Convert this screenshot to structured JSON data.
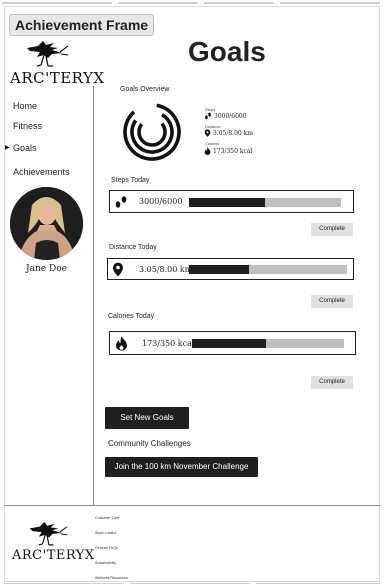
{
  "frame": {
    "label": "Achievement Frame"
  },
  "brand": {
    "logo_text": "ARC'TERYX"
  },
  "page": {
    "title": "Goals"
  },
  "nav": {
    "items": [
      {
        "label": "Home",
        "active": false
      },
      {
        "label": "Fitness",
        "active": false
      },
      {
        "label": "Goals",
        "active": true
      },
      {
        "label": "Achievements",
        "active": false
      }
    ]
  },
  "user": {
    "name": "Jane Doe"
  },
  "overview": {
    "title": "Goals Overview",
    "stats": [
      {
        "caption": "Steps",
        "value": "3000/6000",
        "icon": "footprints-icon"
      },
      {
        "caption": "Distance",
        "value": "3.05/8.00 km",
        "icon": "location-pin-icon"
      },
      {
        "caption": "Calories",
        "value": "173/350 kcal",
        "icon": "flame-icon"
      }
    ]
  },
  "metrics": [
    {
      "title": "Steps Today",
      "value": "3000/6000",
      "icon": "footprints-icon",
      "progress": 0.5,
      "action": "Complete"
    },
    {
      "title": "Distance Today",
      "value": "3.05/8.00 km",
      "icon": "location-pin-icon",
      "progress": 0.38,
      "action": "Complete"
    },
    {
      "title": "Calories Today",
      "value": "173/350 kcal",
      "icon": "flame-icon",
      "progress": 0.49,
      "action": "Complete"
    }
  ],
  "actions": {
    "set_goals": "Set New Goals"
  },
  "community": {
    "heading": "Community Challenges",
    "challenge_button": "Join the 100 km November Challenge"
  },
  "footer": {
    "links": [
      "Customer Care",
      "Store Locator",
      "General FAQs",
      "Sustainability",
      "Wellness Resources"
    ]
  },
  "colors": {
    "accent": "#1f1f1f",
    "track": "#bfbfbf",
    "complete_bg": "#e0e0e0"
  }
}
